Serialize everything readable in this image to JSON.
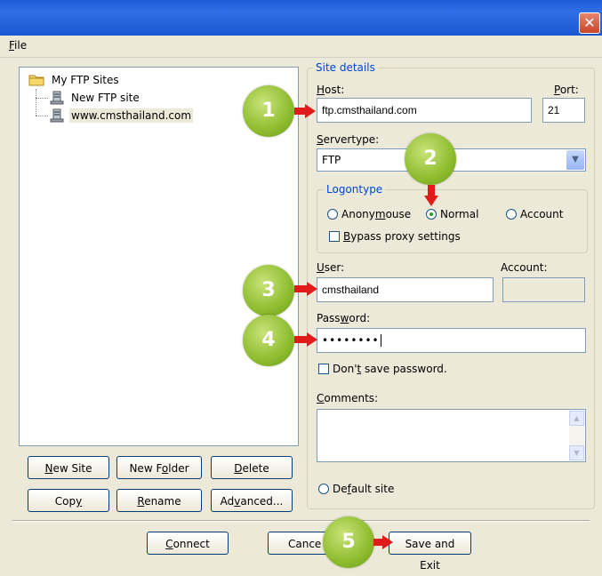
{
  "window": {
    "close_glyph": "✕"
  },
  "menu": {
    "file_first": "F",
    "file_rest": "ile"
  },
  "tree": {
    "root": "My FTP Sites",
    "items": [
      "New FTP site",
      "www.cmsthailand.com"
    ]
  },
  "left_buttons": {
    "new_site": [
      "N",
      "ew Site"
    ],
    "new_folder": [
      "New F",
      "o",
      "lder"
    ],
    "delete": [
      "",
      "D",
      "elete"
    ],
    "copy": [
      "Cop",
      "y",
      ""
    ],
    "rename": [
      "",
      "R",
      "ename"
    ],
    "advanced": [
      "Ad",
      "v",
      "anced..."
    ]
  },
  "site_details": {
    "legend": "Site details",
    "host_label": [
      "",
      "H",
      "ost:"
    ],
    "host_value": "ftp.cmsthailand.com",
    "port_label": [
      "",
      "P",
      "ort:"
    ],
    "port_value": "21",
    "servertype_label": [
      "",
      "S",
      "ervertype:"
    ],
    "servertype_value": "FTP",
    "logontype_legend": "Logontype",
    "logontype_options": [
      "Anonymouse",
      "Normal",
      "Account"
    ],
    "logontype_underline": [
      "Anony",
      "m",
      "ouse"
    ],
    "logontype_selected": "Normal",
    "bypass_proxy": [
      "",
      "B",
      "ypass proxy settings"
    ],
    "user_label": [
      "",
      "U",
      "ser:"
    ],
    "user_value": "cmsthailand",
    "account_label": "Account:",
    "password_label": [
      "Pass",
      "w",
      "ord:"
    ],
    "password_value": "••••••••",
    "dont_save": [
      "Don'",
      "t",
      " save password."
    ],
    "comments_label": [
      "",
      "C",
      "omments:"
    ],
    "default_site": [
      "De",
      "f",
      "ault site"
    ]
  },
  "bottom_buttons": {
    "connect": [
      "",
      "C",
      "onnect"
    ],
    "cancel": "Cance",
    "save_exit": "Save and Exit"
  },
  "callouts": [
    "1",
    "2",
    "3",
    "4",
    "5"
  ],
  "colors": {
    "callout": "#8ebc2e",
    "arrow": "#e11a1a",
    "titlebar": "#2a62d9",
    "legend": "#0046d5"
  }
}
